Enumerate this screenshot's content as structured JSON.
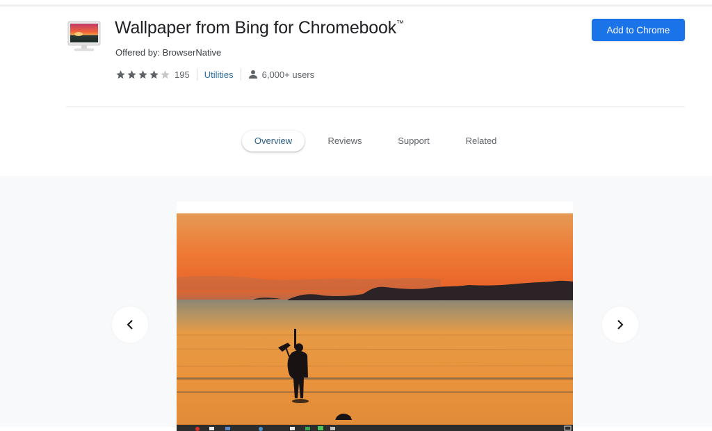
{
  "extension": {
    "icon": "monitor-sunset-icon",
    "title": "Wallpaper from Bing for Chromebook",
    "trademark": "™",
    "offered_by": "Offered by: BrowserNative",
    "rating": 4,
    "rating_max": 5,
    "rating_count": "195",
    "category": "Utilities",
    "users": "6,000+ users",
    "user_icon": "person-icon"
  },
  "actions": {
    "add_button": "Add to Chrome"
  },
  "tabs": [
    {
      "label": "Overview",
      "active": true
    },
    {
      "label": "Reviews",
      "active": false
    },
    {
      "label": "Support",
      "active": false
    },
    {
      "label": "Related",
      "active": false
    }
  ],
  "gallery": {
    "prev_icon": "chevron-left-icon",
    "next_icon": "chevron-right-icon",
    "screenshot_description": "Sunset over the sea with silhouette of a bagpiper standing on the beach",
    "shelf_visible": true
  },
  "colors": {
    "accent": "#1a73e8",
    "tab_active_text": "#2c5f8a",
    "category_link": "#2c6e9e",
    "gallery_bg": "#f8f9fa",
    "star_filled": "#5f6368",
    "star_empty": "#c8c8c8"
  }
}
